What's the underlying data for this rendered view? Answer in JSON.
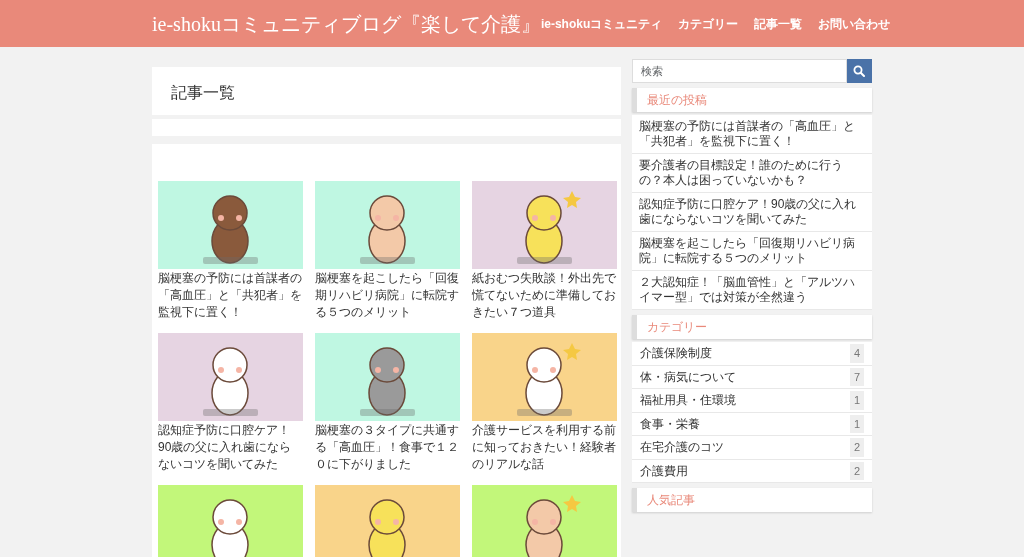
{
  "header": {
    "title": "ie-shokuコミュニティブログ『楽して介護』",
    "nav": [
      "ie-shokuコミュニティ",
      "カテゴリー",
      "記事一覧",
      "お問い合わせ"
    ]
  },
  "page_heading": "記事一覧",
  "posts": [
    {
      "kind": "picture",
      "title": "脳梗塞の予防には首謀者の「高血圧」と「共犯者」を監視下に置く！"
    },
    {
      "kind": "picture",
      "title": "脳梗塞を起こしたら「回復期リハビリ病院」に転院する５つのメリット"
    },
    {
      "kind": "picture",
      "title": "紙おむつ失敗談！外出先で慌てないために準備しておきたい７つ道具"
    },
    {
      "kind": "picture",
      "title": "認知症予防に口腔ケア！90歳の父に入れ歯にならないコツを聞いてみた"
    },
    {
      "kind": "picture",
      "title": "脳梗塞の３タイプに共通する「高血圧」！食事で１２０に下がりました"
    },
    {
      "kind": "picture",
      "title": "介護サービスを利用する前に知っておきたい！経験者のリアルな話"
    },
    {
      "kind": "picture"
    },
    {
      "kind": "picture"
    },
    {
      "kind": "picture"
    }
  ],
  "search": {
    "placeholder": "検索"
  },
  "recent_posts": {
    "heading": "最近の投稿",
    "items": [
      "脳梗塞の予防には首謀者の「高血圧」と「共犯者」を監視下に置く！",
      "要介護者の目標設定！誰のために行うの？本人は困っていないかも？",
      "認知症予防に口腔ケア！90歳の父に入れ歯にならないコツを聞いてみた",
      "脳梗塞を起こしたら「回復期リハビリ病院」に転院する５つのメリット",
      "２大認知症！「脳血管性」と「アルツハイマー型」では対策が全然違う"
    ]
  },
  "categories": {
    "heading": "カテゴリー",
    "items": [
      {
        "label": "介護保険制度",
        "count": "4"
      },
      {
        "label": "体・病気について",
        "count": "7"
      },
      {
        "label": "福祉用具・住環境",
        "count": "1"
      },
      {
        "label": "食事・栄養",
        "count": "1"
      },
      {
        "label": "在宅介護のコツ",
        "count": "2"
      },
      {
        "label": "介護費用",
        "count": "2"
      }
    ]
  },
  "popular": {
    "heading": "人気記事"
  }
}
